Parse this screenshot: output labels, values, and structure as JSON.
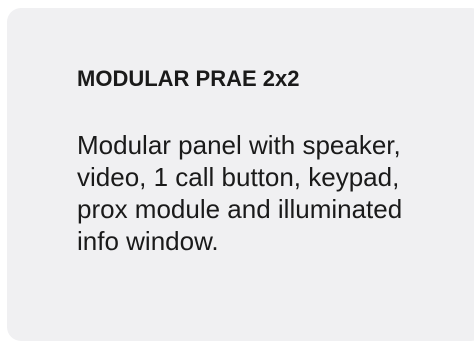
{
  "product_card": {
    "title": "MODULAR PRAE 2x2",
    "description": "Modular panel with speaker, video, 1 call button, keypad, prox module and illuminated info window."
  },
  "colors": {
    "card_background": "#f0f0f2",
    "text": "#1a1a1a"
  }
}
